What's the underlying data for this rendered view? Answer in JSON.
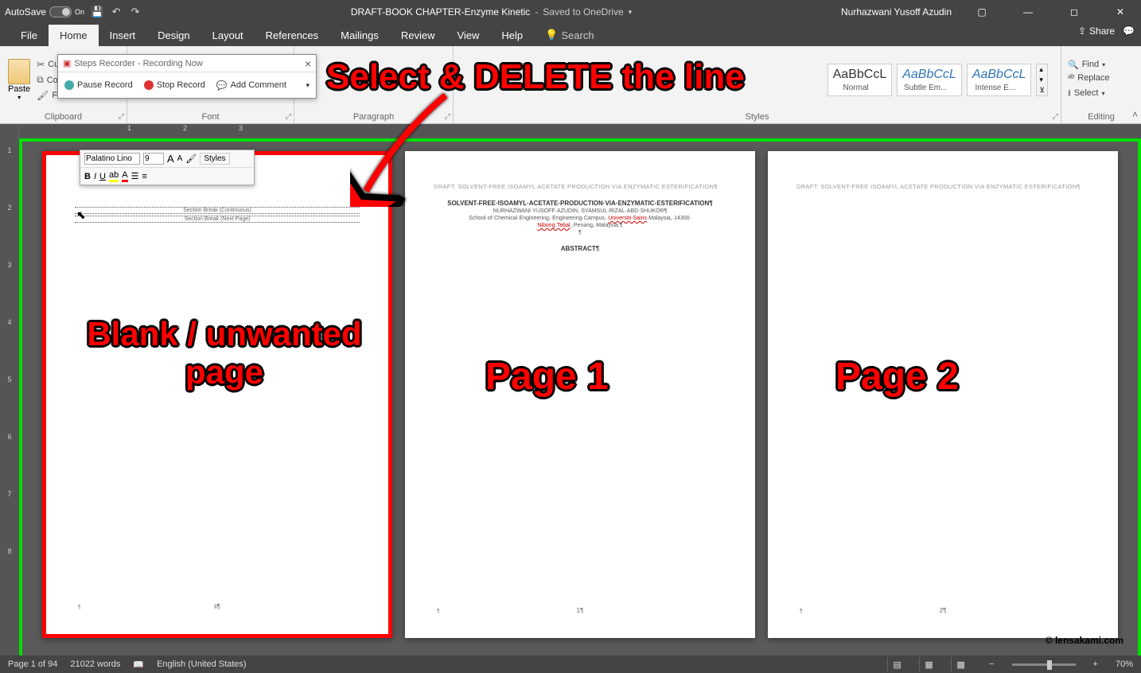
{
  "titlebar": {
    "autosave_label": "AutoSave",
    "autosave_state": "On",
    "doc_title": "DRAFT-BOOK CHAPTER-Enzyme Kinetic",
    "save_status": "Saved to OneDrive",
    "user": "Nurhazwani Yusoff Azudin"
  },
  "tabs": {
    "file": "File",
    "home": "Home",
    "insert": "Insert",
    "design": "Design",
    "layout": "Layout",
    "references": "References",
    "mailings": "Mailings",
    "review": "Review",
    "view": "View",
    "help": "Help",
    "search": "Search"
  },
  "share": {
    "share": "Share",
    "comments": ""
  },
  "ribbon": {
    "clipboard": {
      "paste": "Paste",
      "cut": "Cut",
      "copy": "Copy",
      "fmt": "Format Painter",
      "label": "Clipboard"
    },
    "font": {
      "label": "Font"
    },
    "paragraph": {
      "label": "Paragraph"
    },
    "styles": {
      "label": "Styles",
      "normal": "Normal",
      "subtle": "Subtle Em...",
      "intense": "Intense E...",
      "preview": "AaBbCcL"
    },
    "editing": {
      "label": "Editing",
      "find": "Find",
      "replace": "Replace",
      "select": "Select"
    }
  },
  "dialog": {
    "title": "Steps Recorder - Recording Now",
    "pause": "Pause Record",
    "stop": "Stop Record",
    "comment": "Add Comment"
  },
  "minitoolbar": {
    "font": "Palatino Lino",
    "size": "9",
    "styles": "Styles"
  },
  "ruler_marks": [
    "1",
    "2",
    "3"
  ],
  "vruler_marks": [
    "1",
    "2",
    "3",
    "4",
    "5",
    "6",
    "7",
    "8"
  ],
  "doc": {
    "header": "DRAFT: SOLVENT-FREE ISOAMYL ACETATE PRODUCTION VIA ENZYMATIC ESTERIFICATION¶",
    "sb1": "Section Break (Continuous)",
    "sb2": "Section Break (Next Page)",
    "title": "SOLVENT-FREE·ISOAMYL·ACETATE·PRODUCTION·VIA·ENZYMATIC·ESTERIFICATION¶",
    "authors": "NURHAZWANI·YUSOFF·AZUDIN,·SYAMSUL·RIZAL·ABD·SHUKOR¶",
    "affil1": "School·of·Chemical·Engineering,·Engineering·Campus,·",
    "affil_red": "Universiti·Sains",
    "affil2": "·Malaysia,·14300·",
    "affil3_red": "Nibong·Tebal",
    "affil4": ",·Penang,·Malaysia.¶",
    "abstract": "ABSTRACT¶",
    "pn_blank": "ii¶",
    "pn1": "1¶",
    "pn2": "2¶"
  },
  "annotations": {
    "instruction": "Select & DELETE the line",
    "blank": "Blank / unwanted page",
    "p1": "Page 1",
    "p2": "Page 2"
  },
  "status": {
    "page": "Page 1 of 94",
    "words": "21022 words",
    "lang": "English (United States)",
    "zoom": "70%"
  },
  "watermark": "© lensakami.com"
}
